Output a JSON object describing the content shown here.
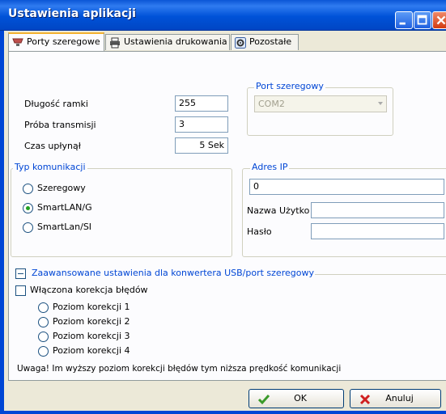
{
  "window": {
    "title": "Ustawienia aplikacji"
  },
  "tabs": [
    {
      "label": "Porty szeregowe",
      "icon": "serial-port-icon",
      "active": true
    },
    {
      "label": "Ustawienia drukowania",
      "icon": "printer-icon",
      "active": false
    },
    {
      "label": "Pozostałe",
      "icon": "settings-icon",
      "active": false
    }
  ],
  "frame": {
    "length_label": "Długość ramki",
    "length_value": "255",
    "retry_label": "Próba transmisji",
    "retry_value": "3",
    "timeout_label": "Czas upłynął",
    "timeout_value": "5 Sek"
  },
  "serial_port": {
    "title": "Port szeregowy",
    "selected": "COM2"
  },
  "comm_type": {
    "title": "Typ komunikacji",
    "options": [
      {
        "label": "Szeregowy",
        "checked": false
      },
      {
        "label": "SmartLAN/G",
        "checked": true
      },
      {
        "label": "SmartLan/SI",
        "checked": false
      }
    ]
  },
  "ip": {
    "title": "Adres IP",
    "address_value": "0",
    "user_label": "Nazwa Użytko",
    "user_value": "",
    "password_label": "Hasło",
    "password_value": ""
  },
  "advanced": {
    "title": "Zaawansowane ustawienia dla konwertera USB/port szeregowy",
    "correction_label": "Włączona korekcja błędów",
    "levels": [
      "Poziom korekcji 1",
      "Poziom korekcji 2",
      "Poziom korekcji 3",
      "Poziom korekcji 4"
    ],
    "note": "Uwaga! Im wyższy poziom korekcji błędów tym niższa prędkość komunikacji"
  },
  "buttons": {
    "ok": "OK",
    "cancel": "Anuluj"
  },
  "colors": {
    "title_bar": "#0052d8",
    "group_title": "#0046d5",
    "radio_checked": "#21a121"
  }
}
